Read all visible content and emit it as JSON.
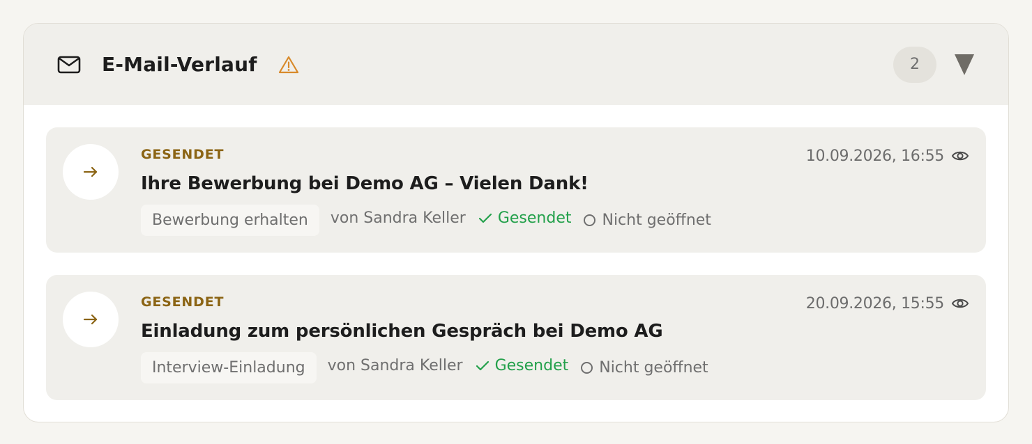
{
  "header": {
    "title": "E-Mail-Verlauf",
    "count": "2",
    "icons": {
      "mail": "mail-icon",
      "warning": "warning-icon",
      "toggle": "triangle-down-icon"
    }
  },
  "emails": [
    {
      "direction_icon": "arrow-right-icon",
      "status_label": "GESENDET",
      "subject": "Ihre Bewerbung bei Demo AG – Vielen Dank!",
      "date": "10.09.2026, 16:55",
      "tag": "Bewerbung erhalten",
      "sender": "von Sandra Keller",
      "sent_status": "Gesendet",
      "opened_status": "Nicht geöffnet"
    },
    {
      "direction_icon": "arrow-right-icon",
      "status_label": "GESENDET",
      "subject": "Einladung zum persönlichen Gespräch bei Demo AG",
      "date": "20.09.2026, 15:55",
      "tag": "Interview-Einladung",
      "sender": "von Sandra Keller",
      "sent_status": "Gesendet",
      "opened_status": "Nicht geöffnet"
    }
  ],
  "colors": {
    "accent": "#8b6414",
    "success": "#22a04a",
    "warning": "#d88a2a",
    "muted": "#6f6f6f"
  }
}
